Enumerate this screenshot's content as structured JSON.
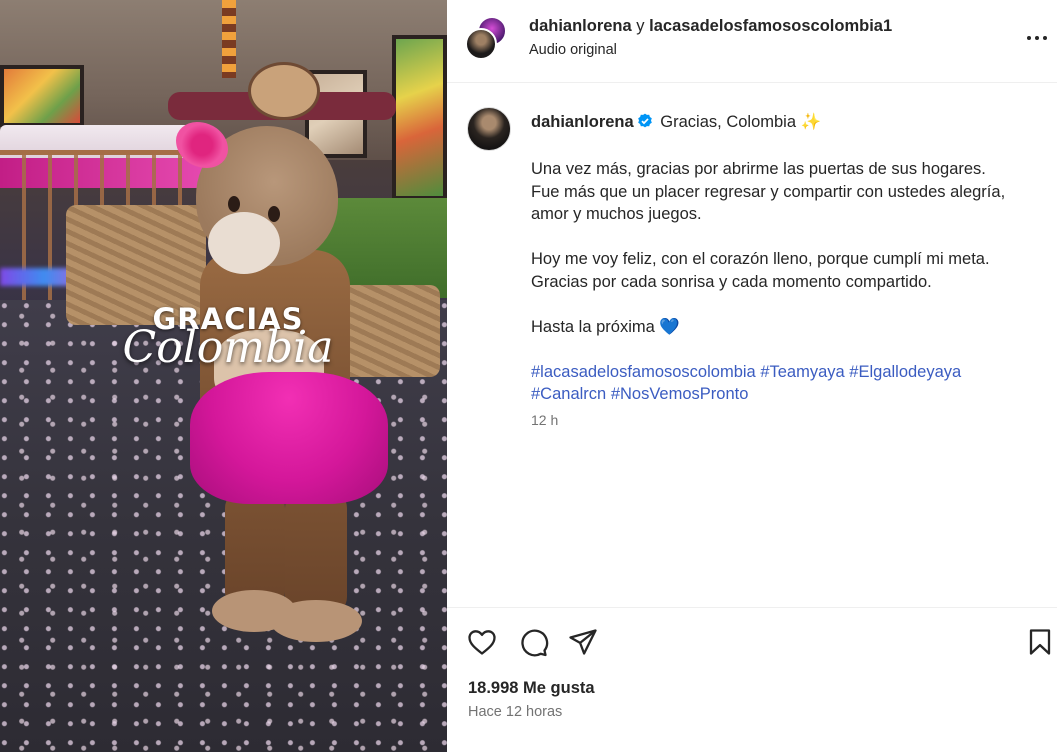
{
  "media": {
    "overlay_line1": "GRACIAS",
    "overlay_line2": "Colombia"
  },
  "header": {
    "user1": "dahianlorena",
    "joiner": "y",
    "user2": "lacasadelosfamososcolombia1",
    "audio": "Audio original",
    "more_icon": "more-icon"
  },
  "caption": {
    "username": "dahianlorena",
    "verified_icon": "verified-badge-icon",
    "first_line": "Gracias, Colombia ✨",
    "paragraph1": "Una vez más, gracias por abrirme las puertas de sus hogares.\nFue más que un placer regresar y compartir con ustedes alegría,\namor y muchos juegos.",
    "paragraph2": "Hoy me voy feliz, con el corazón lleno, porque cumplí mi meta.\nGracias por cada sonrisa y cada momento compartido.",
    "paragraph3": "Hasta la próxima 💙",
    "hashtags": [
      "#lacasadelosfamososcolombia",
      "#Teamyaya",
      "#Elgallodeyaya",
      "#Canalrcn",
      "#NosVemosPronto"
    ],
    "time": "12 h"
  },
  "actions": {
    "like_icon": "heart-icon",
    "comment_icon": "comment-icon",
    "share_icon": "share-icon",
    "save_icon": "bookmark-icon",
    "likes": "18.998 Me gusta",
    "ago": "Hace 12 horas"
  },
  "colors": {
    "hashtag": "#3b5cc1",
    "verified": "#0095f6",
    "text": "#262626",
    "muted": "#737373"
  }
}
